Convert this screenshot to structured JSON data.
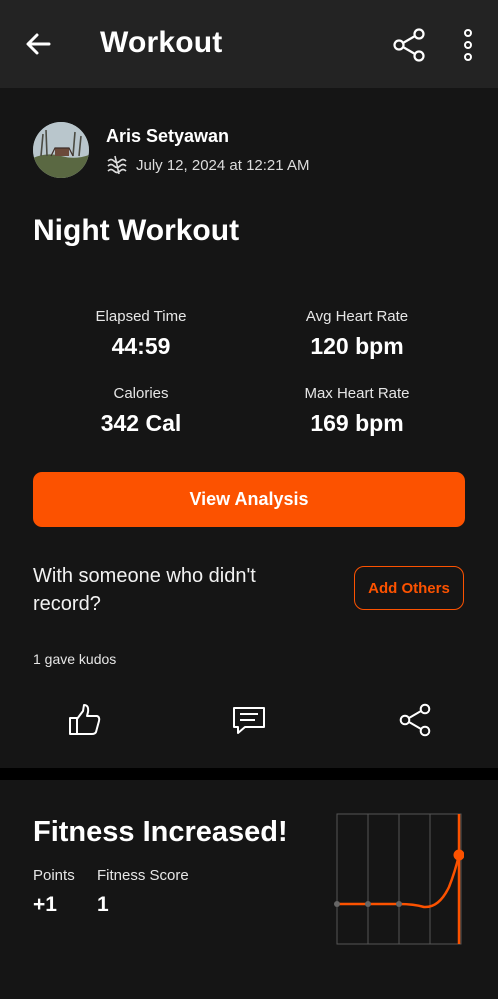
{
  "header": {
    "title": "Workout",
    "back_icon": "arrow-left-icon",
    "share_icon": "share-icon",
    "more_icon": "more-vertical-icon"
  },
  "activity": {
    "author": "Aris Setyawan",
    "datetime": "July 12, 2024 at 12:21 AM",
    "mode_icon": "workout-wave-icon",
    "title": "Night Workout",
    "stats": [
      {
        "label": "Elapsed Time",
        "value": "44:59"
      },
      {
        "label": "Avg Heart Rate",
        "value": "120 bpm"
      },
      {
        "label": "Calories",
        "value": "342 Cal"
      },
      {
        "label": "Max Heart Rate",
        "value": "169 bpm"
      }
    ],
    "analysis_button": "View Analysis",
    "with_someone_text": "With someone who didn't record?",
    "add_others_button": "Add Others",
    "kudos_text": "1 gave kudos",
    "actions": [
      "thumbs-up-icon",
      "comment-icon",
      "share-icon"
    ]
  },
  "fitness": {
    "title": "Fitness Increased!",
    "points_label": "Points",
    "points_value": "+1",
    "score_label": "Fitness Score",
    "score_value": "1"
  },
  "colors": {
    "accent": "#fc5200",
    "background": "#151515",
    "header": "#232323"
  }
}
